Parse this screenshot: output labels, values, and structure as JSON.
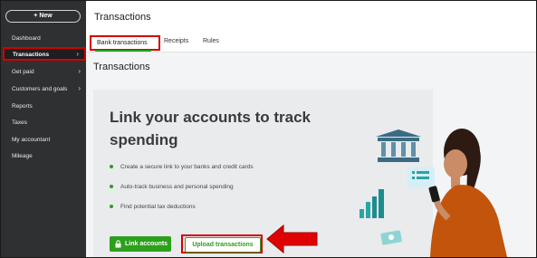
{
  "sidebar": {
    "new_label": "+ New",
    "items": [
      {
        "label": "Dashboard"
      },
      {
        "label": "Transactions",
        "active": true
      },
      {
        "label": "Get paid"
      },
      {
        "label": "Customers and goals"
      },
      {
        "label": "Reports"
      },
      {
        "label": "Taxes"
      },
      {
        "label": "My accountant"
      },
      {
        "label": "Mileage"
      }
    ]
  },
  "header": {
    "title": "Transactions",
    "tabs": [
      {
        "label": "Bank transactions",
        "active": true
      },
      {
        "label": "Receipts"
      },
      {
        "label": "Rules"
      }
    ]
  },
  "main": {
    "section_title": "Transactions",
    "card": {
      "title": "Link your accounts to track spending",
      "bullets": [
        "Create a secure link to your banks and credit cards",
        "Auto-track business and personal spending",
        "Find potential tax deductions"
      ],
      "link_button": "Link accounts",
      "upload_button": "Upload transactions"
    }
  },
  "colors": {
    "accent": "#2ca01c",
    "highlight": "#d40000",
    "sidebar_bg": "#2f3032"
  }
}
